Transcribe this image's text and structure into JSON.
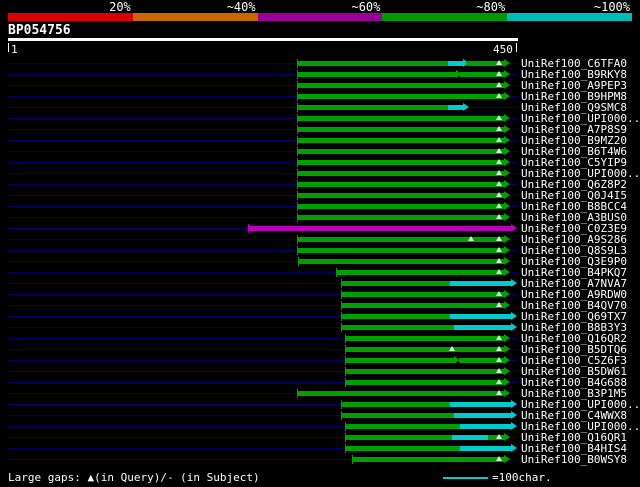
{
  "colors": {
    "background": "#000000",
    "row_line": "#000066",
    "green": "#00a000",
    "cyan": "#00cccc",
    "magenta": "#bb00bb",
    "gap_marker": "#ccffcc",
    "ruler": "#ffffff"
  },
  "scale": {
    "segments": [
      {
        "label": "20%",
        "color": "#dd0000"
      },
      {
        "label": "~40%",
        "color": "#cc6600"
      },
      {
        "label": "~60%",
        "color": "#990099"
      },
      {
        "label": "~80%",
        "color": "#009900"
      },
      {
        "label": "~100%",
        "color": "#00bbbb"
      }
    ]
  },
  "query": {
    "name": "BP054756",
    "ruler_start": "1",
    "ruler_end": "450"
  },
  "footer": {
    "legend_gaps": "Large gaps: ▲(in Query)/- (in Subject)",
    "legend_scale": "=100char."
  },
  "chart_data": {
    "type": "alignment-overview",
    "title": "BP054756",
    "x_axis": {
      "min": 1,
      "max": 450,
      "unit": "query position"
    },
    "identity_scale": [
      "20%",
      "~40%",
      "~60%",
      "~80%",
      "~100%"
    ],
    "rows": [
      {
        "label": "UniRef100_C6TFA0",
        "segments": [
          {
            "start": 255,
            "end": 388,
            "color": "green"
          },
          {
            "start": 388,
            "end": 402,
            "color": "cyan",
            "arrow": true
          },
          {
            "start": 404,
            "end": 438,
            "color": "green",
            "arrow": true
          }
        ],
        "gaps": [
          433
        ]
      },
      {
        "label": "UniRef100_B9RKY8",
        "segments": [
          {
            "start": 255,
            "end": 395,
            "color": "green",
            "arrow": true
          },
          {
            "start": 399,
            "end": 438,
            "color": "green",
            "arrow": true
          }
        ],
        "gaps": [
          433
        ]
      },
      {
        "label": "UniRef100_A9PEP3",
        "segments": [
          {
            "start": 255,
            "end": 438,
            "color": "green",
            "arrow": true
          }
        ],
        "gaps": [
          433
        ]
      },
      {
        "label": "UniRef100_B9HPM8",
        "segments": [
          {
            "start": 255,
            "end": 438,
            "color": "green",
            "arrow": true
          }
        ],
        "gaps": [
          433
        ]
      },
      {
        "label": "UniRef100_Q9SMC8",
        "segments": [
          {
            "start": 255,
            "end": 388,
            "color": "green"
          },
          {
            "start": 388,
            "end": 402,
            "color": "cyan",
            "arrow": true
          }
        ],
        "gaps": []
      },
      {
        "label": "UniRef100_UPI000...",
        "segments": [
          {
            "start": 255,
            "end": 438,
            "color": "green",
            "arrow": true
          }
        ],
        "gaps": [
          433
        ]
      },
      {
        "label": "UniRef100_A7P8S9",
        "segments": [
          {
            "start": 255,
            "end": 438,
            "color": "green",
            "arrow": true
          }
        ],
        "gaps": [
          433
        ]
      },
      {
        "label": "UniRef100_B9MZ20",
        "segments": [
          {
            "start": 255,
            "end": 438,
            "color": "green",
            "arrow": true
          }
        ],
        "gaps": [
          433
        ]
      },
      {
        "label": "UniRef100_B6T4W6",
        "segments": [
          {
            "start": 255,
            "end": 438,
            "color": "green",
            "arrow": true
          }
        ],
        "gaps": [
          433
        ]
      },
      {
        "label": "UniRef100_C5YIP9",
        "segments": [
          {
            "start": 255,
            "end": 438,
            "color": "green",
            "arrow": true
          }
        ],
        "gaps": [
          433
        ]
      },
      {
        "label": "UniRef100_UPI000...",
        "segments": [
          {
            "start": 255,
            "end": 438,
            "color": "green",
            "arrow": true
          }
        ],
        "gaps": [
          433
        ]
      },
      {
        "label": "UniRef100_Q6Z8P2",
        "segments": [
          {
            "start": 255,
            "end": 438,
            "color": "green",
            "arrow": true
          }
        ],
        "gaps": [
          433
        ]
      },
      {
        "label": "UniRef100_Q0J4I5",
        "segments": [
          {
            "start": 255,
            "end": 438,
            "color": "green",
            "arrow": true
          }
        ],
        "gaps": [
          433
        ]
      },
      {
        "label": "UniRef100_B8BCC4",
        "segments": [
          {
            "start": 255,
            "end": 438,
            "color": "green",
            "arrow": true
          }
        ],
        "gaps": [
          433
        ]
      },
      {
        "label": "UniRef100_A3BUS0",
        "segments": [
          {
            "start": 255,
            "end": 438,
            "color": "green",
            "arrow": true
          }
        ],
        "gaps": [
          433
        ]
      },
      {
        "label": "UniRef100_C0Z3E9",
        "segments": [
          {
            "start": 212,
            "end": 444,
            "color": "magenta",
            "arrow": true
          }
        ],
        "gaps": []
      },
      {
        "label": "UniRef100_A9S286",
        "segments": [
          {
            "start": 255,
            "end": 438,
            "color": "green",
            "arrow": true
          }
        ],
        "gaps": [
          409,
          433
        ]
      },
      {
        "label": "UniRef100_Q8S9L3",
        "segments": [
          {
            "start": 255,
            "end": 438,
            "color": "green",
            "arrow": true
          }
        ],
        "gaps": [
          433
        ]
      },
      {
        "label": "UniRef100_Q3E9P0",
        "segments": [
          {
            "start": 256,
            "end": 438,
            "color": "green",
            "arrow": true
          }
        ],
        "gaps": [
          433
        ]
      },
      {
        "label": "UniRef100_B4PKQ7",
        "segments": [
          {
            "start": 290,
            "end": 438,
            "color": "green",
            "arrow": true
          }
        ],
        "gaps": [
          433
        ]
      },
      {
        "label": "UniRef100_A7NVA7",
        "segments": [
          {
            "start": 294,
            "end": 390,
            "color": "green"
          },
          {
            "start": 390,
            "end": 444,
            "color": "cyan",
            "arrow": true
          }
        ],
        "gaps": []
      },
      {
        "label": "UniRef100_A9RDW0",
        "segments": [
          {
            "start": 294,
            "end": 438,
            "color": "green",
            "arrow": true
          }
        ],
        "gaps": [
          433
        ]
      },
      {
        "label": "UniRef100_B4QV70",
        "segments": [
          {
            "start": 294,
            "end": 438,
            "color": "green",
            "arrow": true
          }
        ],
        "gaps": [
          433
        ]
      },
      {
        "label": "UniRef100_Q69TX7",
        "segments": [
          {
            "start": 294,
            "end": 390,
            "color": "green"
          },
          {
            "start": 390,
            "end": 444,
            "color": "cyan",
            "arrow": true
          }
        ],
        "gaps": []
      },
      {
        "label": "UniRef100_B8B3Y3",
        "segments": [
          {
            "start": 294,
            "end": 394,
            "color": "green"
          },
          {
            "start": 394,
            "end": 444,
            "color": "cyan",
            "arrow": true
          }
        ],
        "gaps": []
      },
      {
        "label": "UniRef100_Q16QR2",
        "segments": [
          {
            "start": 298,
            "end": 438,
            "color": "green",
            "arrow": true
          }
        ],
        "gaps": [
          433
        ]
      },
      {
        "label": "UniRef100_B5DTQ6",
        "segments": [
          {
            "start": 298,
            "end": 438,
            "color": "green",
            "arrow": true
          }
        ],
        "gaps": [
          392,
          433
        ]
      },
      {
        "label": "UniRef100_C5Z6F3",
        "segments": [
          {
            "start": 298,
            "end": 394,
            "color": "green",
            "arrow": true
          },
          {
            "start": 398,
            "end": 438,
            "color": "green",
            "arrow": true
          }
        ],
        "gaps": [
          433
        ]
      },
      {
        "label": "UniRef100_B5DW61",
        "segments": [
          {
            "start": 298,
            "end": 438,
            "color": "green",
            "arrow": true
          }
        ],
        "gaps": [
          433
        ]
      },
      {
        "label": "UniRef100_B4G688",
        "segments": [
          {
            "start": 298,
            "end": 438,
            "color": "green",
            "arrow": true
          }
        ],
        "gaps": [
          433
        ]
      },
      {
        "label": "UniRef100_B3P1M5",
        "segments": [
          {
            "start": 255,
            "end": 438,
            "color": "green",
            "arrow": true
          }
        ],
        "gaps": [
          433
        ]
      },
      {
        "label": "UniRef100_UPI000...",
        "segments": [
          {
            "start": 294,
            "end": 390,
            "color": "green"
          },
          {
            "start": 390,
            "end": 444,
            "color": "cyan",
            "arrow": true
          }
        ],
        "gaps": []
      },
      {
        "label": "UniRef100_C4WWX8",
        "segments": [
          {
            "start": 294,
            "end": 394,
            "color": "green"
          },
          {
            "start": 394,
            "end": 444,
            "color": "cyan",
            "arrow": true
          }
        ],
        "gaps": []
      },
      {
        "label": "UniRef100_UPI000...",
        "segments": [
          {
            "start": 298,
            "end": 399,
            "color": "green"
          },
          {
            "start": 399,
            "end": 444,
            "color": "cyan",
            "arrow": true
          }
        ],
        "gaps": []
      },
      {
        "label": "UniRef100_Q16QR1",
        "segments": [
          {
            "start": 298,
            "end": 392,
            "color": "green"
          },
          {
            "start": 392,
            "end": 424,
            "color": "cyan"
          },
          {
            "start": 424,
            "end": 438,
            "color": "green",
            "arrow": true
          }
        ],
        "gaps": [
          433
        ]
      },
      {
        "label": "UniRef100_B4HIS4",
        "segments": [
          {
            "start": 298,
            "end": 399,
            "color": "green"
          },
          {
            "start": 399,
            "end": 444,
            "color": "cyan",
            "arrow": true
          }
        ],
        "gaps": []
      },
      {
        "label": "UniRef100_B0WSY8",
        "segments": [
          {
            "start": 304,
            "end": 438,
            "color": "green",
            "arrow": true
          }
        ],
        "gaps": [
          433
        ]
      }
    ]
  }
}
